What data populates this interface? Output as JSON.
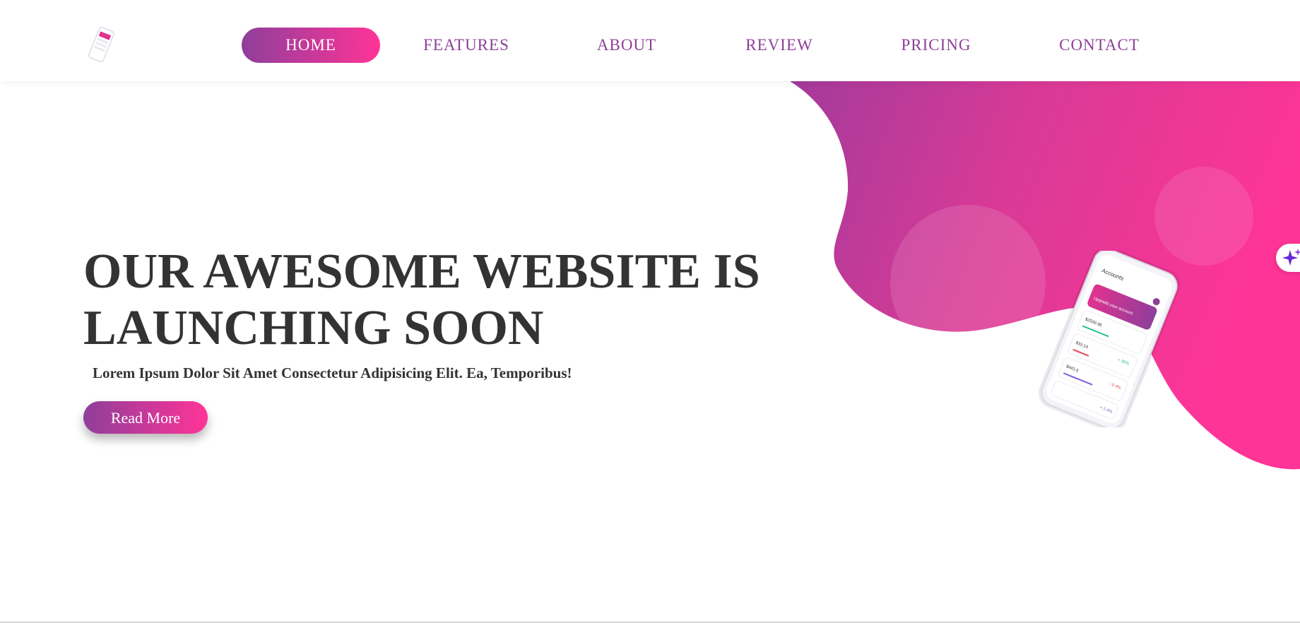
{
  "nav": {
    "items": [
      {
        "label": "HOME",
        "active": true
      },
      {
        "label": "FEATURES",
        "active": false
      },
      {
        "label": "ABOUT",
        "active": false
      },
      {
        "label": "REVIEW",
        "active": false
      },
      {
        "label": "PRICING",
        "active": false
      },
      {
        "label": "CONTACT",
        "active": false
      }
    ]
  },
  "hero": {
    "title_line1": "OUR AWESOME WEBSITE IS",
    "title_line2": "LAUNCHING SOON",
    "subtitle": "Lorem Ipsum Dolor Sit Amet Consectetur Adipisicing Elit. Ea, Temporibus!",
    "cta_label": "Read More"
  },
  "phone_screen": {
    "header": "Accounts",
    "banner": "Upgrade your account",
    "balance": "$2500.95",
    "rows": [
      {
        "amount": "$33.14",
        "change": "+ 30%"
      },
      {
        "amount": "$441.6",
        "change": "- 0.4%"
      },
      {
        "amount": "",
        "change": "+ 2.4%"
      }
    ]
  },
  "icons": {
    "logo": "phone-logo-icon",
    "widget": "sparkle-icon"
  },
  "colors": {
    "gradient_start": "#8f3e9b",
    "gradient_end": "#ff3497",
    "nav_text": "#8e3f97",
    "heading_text": "#333333"
  }
}
